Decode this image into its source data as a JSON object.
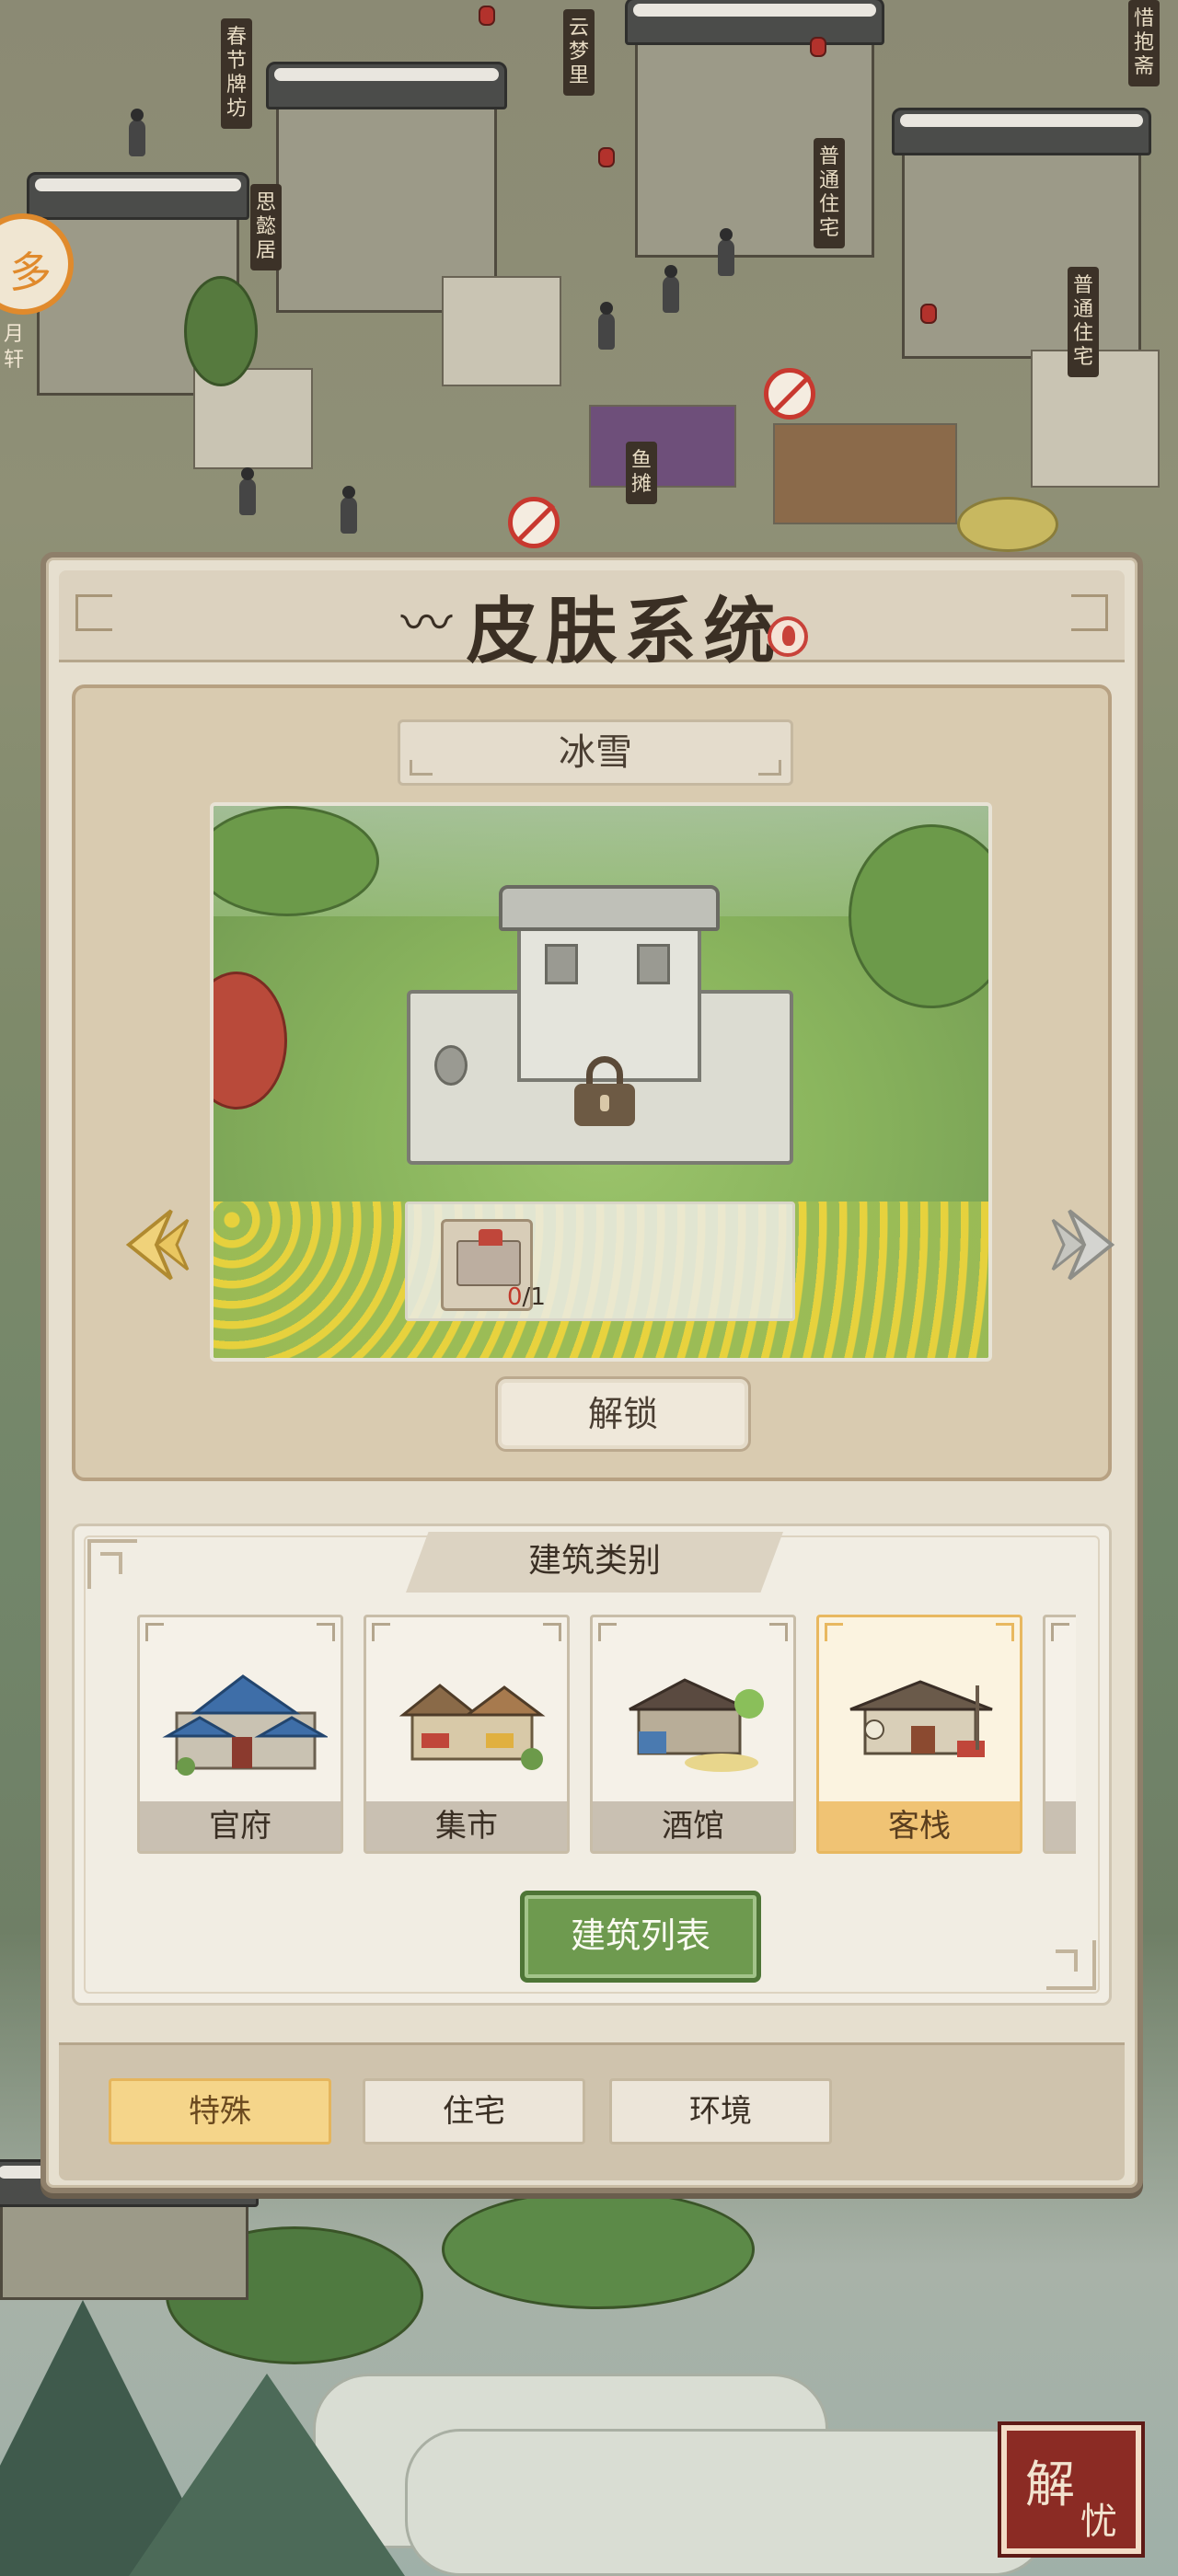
{
  "map": {
    "signs": [
      "春节牌坊",
      "思懿居",
      "云梦里",
      "普通住宅",
      "普通住宅",
      "鱼摊",
      "惜抱斋"
    ],
    "side_badge_label": "月轩",
    "seal_button": [
      "解",
      "忧"
    ]
  },
  "modal": {
    "title": "皮肤系统",
    "skin_name": "冰雪",
    "requirement_count_have": "0",
    "requirement_count_sep": "/",
    "requirement_count_need": "1",
    "unlock_label": "解锁",
    "category_header": "建筑类别",
    "categories": [
      {
        "label": "官府",
        "selected": false
      },
      {
        "label": "集市",
        "selected": false
      },
      {
        "label": "酒馆",
        "selected": false
      },
      {
        "label": "客栈",
        "selected": true
      }
    ],
    "building_list_label": "建筑列表",
    "tabs": [
      {
        "label": "特殊",
        "active": true
      },
      {
        "label": "住宅",
        "active": false
      },
      {
        "label": "环境",
        "active": false
      }
    ]
  },
  "colors": {
    "panel": "#e6dfcf",
    "selected": "#f0c374",
    "green_button": "#6e9a4f",
    "accent_red": "#c8382f"
  }
}
